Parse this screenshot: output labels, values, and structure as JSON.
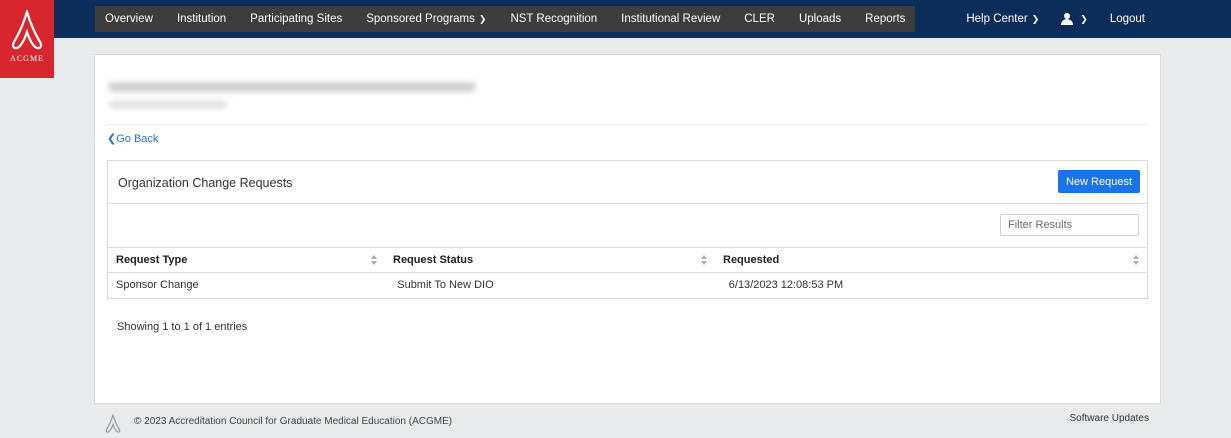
{
  "brand": {
    "logo_text": "ACGME",
    "color": "#d8262e"
  },
  "nav": {
    "items": [
      {
        "label": "Overview",
        "chevron": false
      },
      {
        "label": "Institution",
        "chevron": false
      },
      {
        "label": "Participating Sites",
        "chevron": false
      },
      {
        "label": "Sponsored Programs",
        "chevron": true
      },
      {
        "label": "NST Recognition",
        "chevron": false
      },
      {
        "label": "Institutional Review",
        "chevron": false
      },
      {
        "label": "CLER",
        "chevron": false
      },
      {
        "label": "Uploads",
        "chevron": false
      },
      {
        "label": "Reports",
        "chevron": false
      }
    ],
    "help_label": "Help Center",
    "logout_label": "Logout",
    "colors": {
      "navbar": "#0c2d5a",
      "menu_bg": "#3d3d3d"
    }
  },
  "page": {
    "go_back": "Go Back",
    "card": {
      "title": "Organization Change Requests",
      "new_button": "New Request",
      "filter_placeholder": "Filter Results"
    },
    "table": {
      "columns": [
        "Request Type",
        "Request Status",
        "Requested"
      ],
      "rows": [
        [
          "Sponsor Change",
          "Submit To New DIO",
          "6/13/2023 12:08:53 PM"
        ]
      ]
    },
    "showing": "Showing 1 to 1 of 1 entries"
  },
  "footer": {
    "copyright": "© 2023 Accreditation Council for Graduate Medical Education (ACGME)",
    "software_updates": "Software Updates"
  },
  "accent": "#1a73e8"
}
